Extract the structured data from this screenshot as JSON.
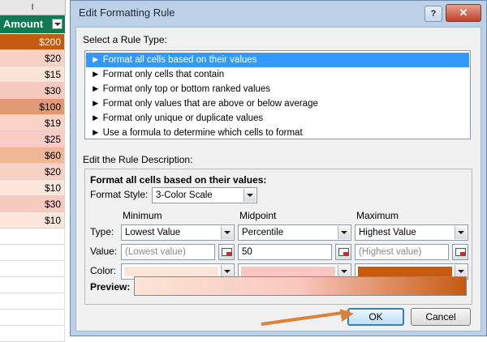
{
  "sheet": {
    "column_letter": "I",
    "header": "Amount",
    "cells": [
      {
        "value": "$200",
        "color": "#c55a11",
        "text_color": "#ffffff"
      },
      {
        "value": "$20",
        "color": "#f8d0c4",
        "text_color": "#000000"
      },
      {
        "value": "$15",
        "color": "#fbe3d6",
        "text_color": "#000000"
      },
      {
        "value": "$30",
        "color": "#f8c9bf",
        "text_color": "#000000"
      },
      {
        "value": "$100",
        "color": "#e09a73",
        "text_color": "#000000"
      },
      {
        "value": "$19",
        "color": "#f9d2c8",
        "text_color": "#000000"
      },
      {
        "value": "$25",
        "color": "#f9cdc3",
        "text_color": "#000000"
      },
      {
        "value": "$60",
        "color": "#f0b796",
        "text_color": "#000000"
      },
      {
        "value": "$20",
        "color": "#f8d0c4",
        "text_color": "#000000"
      },
      {
        "value": "$10",
        "color": "#fce7da",
        "text_color": "#000000"
      },
      {
        "value": "$30",
        "color": "#f8c9bf",
        "text_color": "#000000"
      },
      {
        "value": "$10",
        "color": "#fce7da",
        "text_color": "#000000"
      }
    ]
  },
  "dialog": {
    "title": "Edit Formatting Rule",
    "help_label": "?",
    "close_label": "✕",
    "select_rule_type_label": "Select a Rule Type:",
    "rule_types": [
      {
        "label": "► Format all cells based on their values",
        "selected": true
      },
      {
        "label": "► Format only cells that contain",
        "selected": false
      },
      {
        "label": "► Format only top or bottom ranked values",
        "selected": false
      },
      {
        "label": "► Format only values that are above or below average",
        "selected": false
      },
      {
        "label": "► Format only unique or duplicate values",
        "selected": false
      },
      {
        "label": "► Use a formula to determine which cells to format",
        "selected": false
      }
    ],
    "edit_description_label": "Edit the Rule Description:",
    "description_heading": "Format all cells based on their values:",
    "format_style_label": "Format Style:",
    "format_style_value": "3-Color Scale",
    "row_labels": {
      "type": "Type:",
      "value": "Value:",
      "color": "Color:"
    },
    "columns": [
      {
        "heading": "Minimum",
        "type": "Lowest Value",
        "value": "(Lowest value)",
        "value_dimmed": true,
        "color": "#fce4d6"
      },
      {
        "heading": "Midpoint",
        "type": "Percentile",
        "value": "50",
        "value_dimmed": false,
        "color": "#f9c7be"
      },
      {
        "heading": "Maximum",
        "type": "Highest Value",
        "value": "(Highest value)",
        "value_dimmed": true,
        "color": "#c55a11"
      }
    ],
    "preview_label": "Preview:",
    "ok_label": "OK",
    "cancel_label": "Cancel"
  },
  "colors": {
    "header_green": "#0e7a52",
    "selection_blue": "#3399ff",
    "arrow_orange": "#d9823a"
  }
}
